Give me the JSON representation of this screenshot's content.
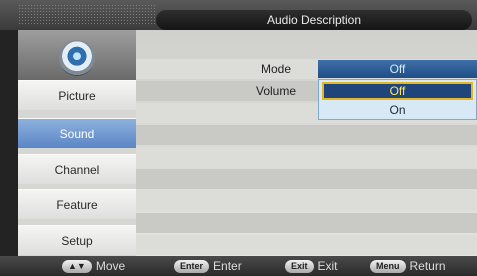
{
  "header": {
    "title": "Audio Description"
  },
  "sidebar": {
    "logo_icon": "tv-logo-icon",
    "items": [
      {
        "label": "Picture",
        "active": false
      },
      {
        "label": "Sound",
        "active": true
      },
      {
        "label": "Channel",
        "active": false
      },
      {
        "label": "Feature",
        "active": false
      },
      {
        "label": "Setup",
        "active": false
      }
    ]
  },
  "settings": {
    "mode": {
      "label": "Mode",
      "value": "Off"
    },
    "volume": {
      "label": "Volume"
    }
  },
  "dropdown": {
    "options": [
      "Off",
      "On"
    ],
    "selected": "Off"
  },
  "footer": {
    "move": {
      "key": "▲▼",
      "label": "Move"
    },
    "enter": {
      "key": "Enter",
      "label": "Enter"
    },
    "exit": {
      "key": "Exit",
      "label": "Exit"
    },
    "menu": {
      "key": "Menu",
      "label": "Return"
    }
  },
  "colors": {
    "accent": "#5b86c6",
    "selected_value_bg": "#20457a",
    "highlight_text": "#ffe45a"
  }
}
